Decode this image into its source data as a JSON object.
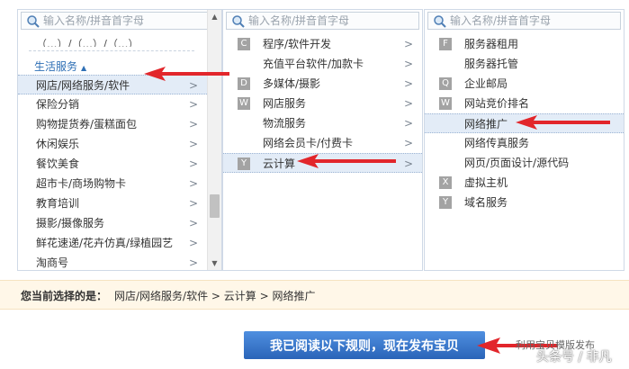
{
  "search": {
    "placeholder": "输入名称/拼音首字母"
  },
  "col1": {
    "partial_top": "（...）/（...）/（...）",
    "group_label": "生活服务",
    "items": [
      {
        "label": "网店/网络服务/软件"
      },
      {
        "label": "保险分销"
      },
      {
        "label": "购物提货券/蛋糕面包"
      },
      {
        "label": "休闲娱乐"
      },
      {
        "label": "餐饮美食"
      },
      {
        "label": "超市卡/商场购物卡"
      },
      {
        "label": "教育培训"
      },
      {
        "label": "摄影/摄像服务"
      },
      {
        "label": "鲜花速递/花卉仿真/绿植园艺"
      },
      {
        "label": "淘商号"
      }
    ]
  },
  "col2": {
    "items": [
      {
        "key": "C",
        "label": "程序/软件开发"
      },
      {
        "key": "",
        "label": "充值平台软件/加款卡"
      },
      {
        "key": "D",
        "label": "多媒体/摄影"
      },
      {
        "key": "W",
        "label": "网店服务"
      },
      {
        "key": "",
        "label": "物流服务"
      },
      {
        "key": "",
        "label": "网络会员卡/付费卡"
      },
      {
        "key": "Y",
        "label": "云计算"
      }
    ]
  },
  "col3": {
    "items": [
      {
        "key": "F",
        "label": "服务器租用"
      },
      {
        "key": "",
        "label": "服务器托管"
      },
      {
        "key": "Q",
        "label": "企业邮局"
      },
      {
        "key": "W",
        "label": "网站竞价排名"
      },
      {
        "key": "",
        "label": "网络推广"
      },
      {
        "key": "",
        "label": "网络传真服务"
      },
      {
        "key": "",
        "label": "网页/页面设计/源代码"
      },
      {
        "key": "X",
        "label": "虚拟主机"
      },
      {
        "key": "Y",
        "label": "域名服务"
      }
    ]
  },
  "selection": {
    "prefix": "您当前选择的是：",
    "path": "网店/网络服务/软件 > 云计算 > 网络推广"
  },
  "publish_button": "我已阅读以下规则，现在发布宝贝",
  "template_link": "利用宝贝模版发布",
  "watermark": "头条号 / 非凡",
  "colors": {
    "selected_bg": "#e3ecf7",
    "group_text": "#2e6fb5",
    "bar_bg": "#fff7e8",
    "button": "#2a64b8",
    "arrow": "#e2262b"
  },
  "icons": {
    "search": "magnifier-icon",
    "chevron": "chevron-right-icon",
    "scroll_up": "scroll-up-icon",
    "scroll_down": "scroll-down-icon",
    "annotation": "red-arrow-icon"
  }
}
